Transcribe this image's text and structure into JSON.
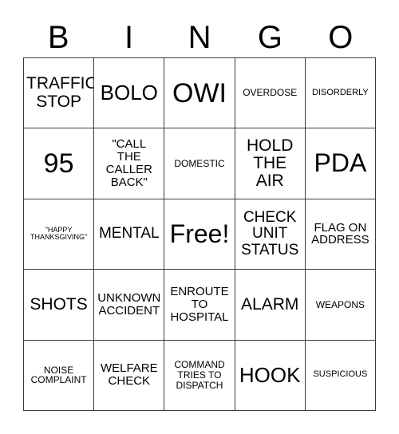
{
  "card": {
    "header_letters": [
      "B",
      "I",
      "N",
      "G",
      "O"
    ],
    "free_space_label": "Free!",
    "rows": [
      [
        {
          "text": "TRAFFIC\nSTOP",
          "size": "md"
        },
        {
          "text": "BOLO",
          "size": "lg"
        },
        {
          "text": "OWI",
          "size": "xxl"
        },
        {
          "text": "OVERDOSE",
          "size": "xxs"
        },
        {
          "text": "DISORDERLY",
          "size": "tiny"
        }
      ],
      [
        {
          "text": "95",
          "size": "xxl"
        },
        {
          "text": "\"CALL\nTHE\nCALLER\nBACK\"",
          "size": "xs"
        },
        {
          "text": "DOMESTIC",
          "size": "xxs"
        },
        {
          "text": "HOLD\nTHE\nAIR",
          "size": "md"
        },
        {
          "text": "PDA",
          "size": "xl"
        }
      ],
      [
        {
          "text": "\"HAPPY\nTHANKSGIVING\"",
          "size": "mini"
        },
        {
          "text": "MENTAL",
          "size": "sm"
        },
        {
          "text": "Free!",
          "size": "xl"
        },
        {
          "text": "CHECK\nUNIT\nSTATUS",
          "size": "sm"
        },
        {
          "text": "FLAG ON\nADDRESS",
          "size": "xs"
        }
      ],
      [
        {
          "text": "SHOTS",
          "size": "md"
        },
        {
          "text": "UNKNOWN\nACCIDENT",
          "size": "xs"
        },
        {
          "text": "ENROUTE\nTO\nHOSPITAL",
          "size": "xs"
        },
        {
          "text": "ALARM",
          "size": "md"
        },
        {
          "text": "WEAPONS",
          "size": "xxs"
        }
      ],
      [
        {
          "text": "NOISE\nCOMPLAINT",
          "size": "xxs"
        },
        {
          "text": "WELFARE\nCHECK",
          "size": "xs"
        },
        {
          "text": "COMMAND\nTRIES TO\nDISPATCH",
          "size": "xxs"
        },
        {
          "text": "HOOK",
          "size": "lg"
        },
        {
          "text": "SUSPICIOUS",
          "size": "tiny"
        }
      ]
    ]
  },
  "colors": {
    "grid_line": "#3a3a3a",
    "text": "#000000",
    "background": "#ffffff"
  }
}
